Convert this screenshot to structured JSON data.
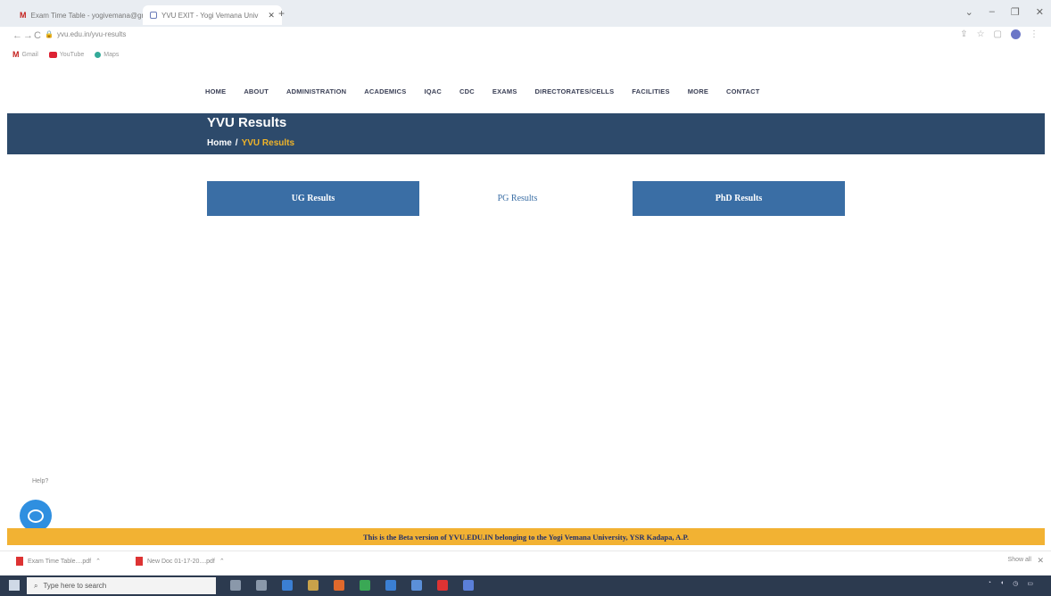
{
  "browser": {
    "tabs": [
      {
        "label": "Exam Time Table - yogivemana@gm"
      },
      {
        "label": "YVU EXIT - Yogi Vemana Univ"
      }
    ],
    "url": "yvu.edu.in/yvu-results",
    "bookmarks": [
      "Gmail",
      "YouTube",
      "Maps"
    ]
  },
  "nav": [
    "HOME",
    "ABOUT",
    "ADMINISTRATION",
    "ACADEMICS",
    "IQAC",
    "CDC",
    "EXAMS",
    "DIRECTORATES/CELLS",
    "FACILITIES",
    "MORE",
    "CONTACT"
  ],
  "page": {
    "title": "YVU Results",
    "breadcrumb_home": "Home",
    "breadcrumb_sep": "/",
    "breadcrumb_current": "YVU Results"
  },
  "results": {
    "ug": "UG Results",
    "pg": "PG Results",
    "phd": "PhD Results"
  },
  "help_label": "Help?",
  "beta_banner": "This is the Beta version of YVU.EDU.IN belonging to the Yogi Vemana University, YSR Kadapa, A.P.",
  "downloads": {
    "items": [
      "Exam Time Table....pdf",
      "New Doc 01-17-20....pdf"
    ],
    "show_all": "Show all"
  },
  "taskbar": {
    "search_placeholder": "Type here to search"
  },
  "colors": {
    "band": "#2d4a6b",
    "button": "#3a6ea5",
    "accent": "#f0b429",
    "banner": "#f2b233"
  }
}
